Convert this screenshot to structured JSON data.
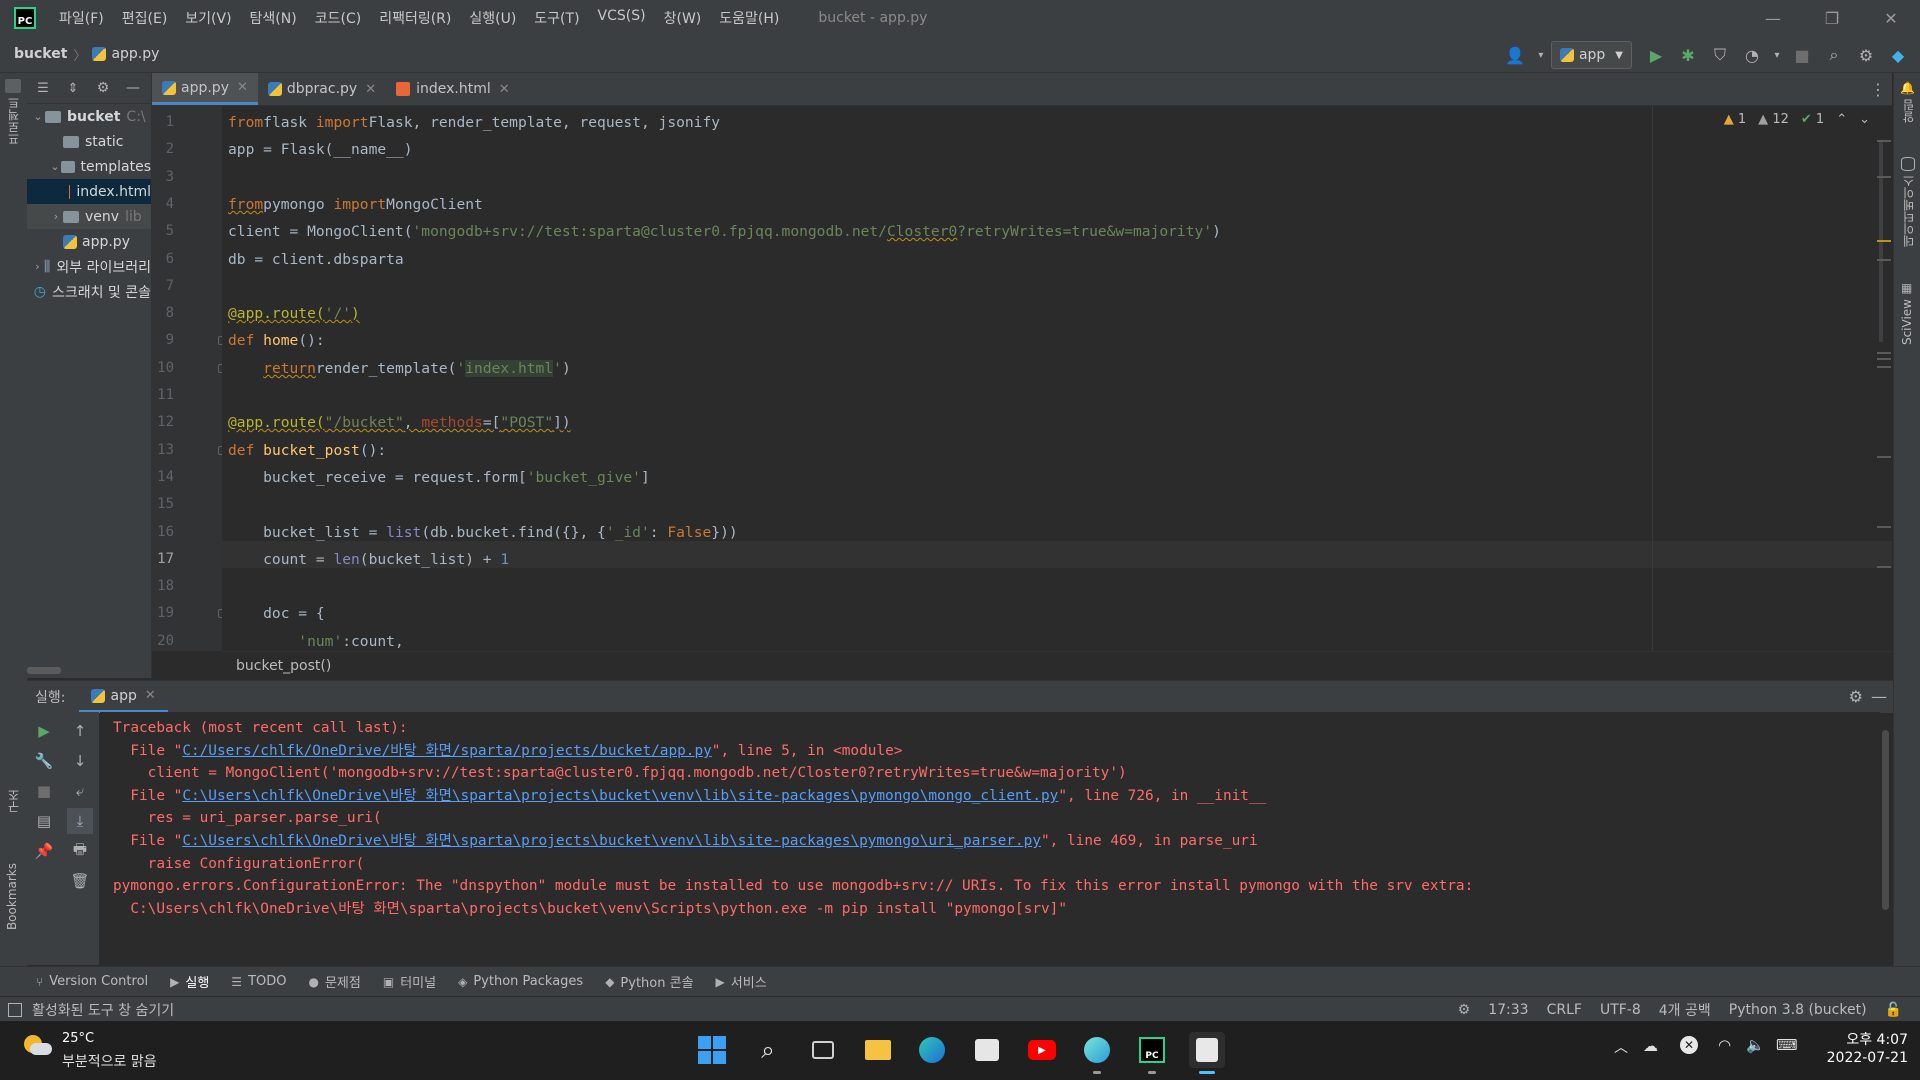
{
  "menu": [
    "파일(F)",
    "편집(E)",
    "보기(V)",
    "탐색(N)",
    "코드(C)",
    "리팩터링(R)",
    "실행(U)",
    "도구(T)",
    "VCS(S)",
    "창(W)",
    "도움말(H)"
  ],
  "window_title": "bucket - app.py",
  "app_logo_text": "PC",
  "breadcrumb": {
    "project": "bucket",
    "file": "app.py"
  },
  "run_config": "app",
  "left_strip": {
    "project": "프로젝트",
    "structure": "구조",
    "bookmarks": "Bookmarks"
  },
  "right_strip": {
    "notifications": "알림",
    "database": "데이터베이스",
    "sciview": "SciView"
  },
  "project_tree": [
    {
      "label": "bucket",
      "extra": "C:\\",
      "indent": 0,
      "arrow": "down",
      "icon": "folder-icon",
      "bold": true
    },
    {
      "label": "static",
      "extra": "",
      "indent": 1,
      "arrow": "",
      "icon": "folder-icon"
    },
    {
      "label": "templates",
      "extra": "",
      "indent": 1,
      "arrow": "down",
      "icon": "folder-icon"
    },
    {
      "label": "index.html",
      "extra": "",
      "indent": 2,
      "arrow": "",
      "icon": "html-file-icon",
      "selected": true
    },
    {
      "label": "venv",
      "extra": "lib",
      "indent": 1,
      "arrow": "right",
      "icon": "folder-icon",
      "highlight": true
    },
    {
      "label": "app.py",
      "extra": "",
      "indent": 1,
      "arrow": "",
      "icon": "python-file-icon"
    },
    {
      "label": "외부 라이브러리",
      "extra": "",
      "indent": 0,
      "arrow": "right",
      "icon": "library-icon"
    },
    {
      "label": "스크래치 및 콘솔",
      "extra": "",
      "indent": 0,
      "arrow": "",
      "icon": "scratch-icon"
    }
  ],
  "tabs": [
    {
      "label": "app.py",
      "icon": "python-file-icon",
      "active": true
    },
    {
      "label": "dbprac.py",
      "icon": "python-file-icon",
      "active": false
    },
    {
      "label": "index.html",
      "icon": "html-file-icon",
      "active": false
    }
  ],
  "inspections": {
    "warnings": "1",
    "weak_warnings": "12",
    "ok": "1"
  },
  "current_line": "17",
  "code_lines": [
    [
      [
        "kw",
        "from"
      ],
      [
        "",
        "flask "
      ],
      [
        "kw",
        "import"
      ],
      [
        "",
        "Flask, render_template, request, jsonify"
      ]
    ],
    [
      [
        "",
        "app = Flask(__name__)"
      ]
    ],
    [],
    [
      [
        "kw wavy",
        "from"
      ],
      [
        "",
        "pymongo "
      ],
      [
        "kw",
        "import"
      ],
      [
        "",
        "MongoClient"
      ]
    ],
    [
      [
        "",
        "client = MongoClient("
      ],
      [
        "str",
        "'mongodb+srv://test:sparta@cluster0.fpjqq.mongodb.net/"
      ],
      [
        "str wavy",
        "Closter0"
      ],
      [
        "str",
        "?retryWrites=true&w=majority'"
      ],
      [
        "",
        ")"
      ]
    ],
    [
      [
        "",
        "db = client.dbsparta"
      ]
    ],
    [],
    [
      [
        "deco wavy",
        "@app.route("
      ],
      [
        "str wavy",
        "'/'"
      ],
      [
        "deco wavy",
        ")"
      ]
    ],
    [
      [
        "kw",
        "def "
      ],
      [
        "fn",
        "home"
      ],
      [
        "",
        "():"
      ]
    ],
    [
      [
        "",
        "    "
      ],
      [
        "kw wavy",
        "return"
      ],
      [
        "",
        "render_template("
      ],
      [
        "str",
        "'"
      ],
      [
        "hl",
        "index.html"
      ],
      [
        "str",
        "'"
      ],
      [
        "",
        ")"
      ]
    ],
    [],
    [
      [
        "deco wavy",
        "@app.route("
      ],
      [
        "str wavy",
        "\"/bucket\""
      ],
      [
        "wavy",
        ", "
      ],
      [
        "param wavy",
        "methods"
      ],
      [
        "wavy",
        "=["
      ],
      [
        "str wavy",
        "\"POST\""
      ],
      [
        "wavy",
        "])"
      ]
    ],
    [
      [
        "kw",
        "def "
      ],
      [
        "fn",
        "bucket_post"
      ],
      [
        "",
        "():"
      ]
    ],
    [
      [
        "",
        "    bucket_receive = request.form["
      ],
      [
        "str",
        "'bucket_give'"
      ],
      [
        "",
        "]"
      ]
    ],
    [],
    [
      [
        "",
        "    bucket_list = "
      ],
      [
        "bi",
        "list"
      ],
      [
        "",
        "(db.bucket.find({}, {"
      ],
      [
        "str",
        "'_id'"
      ],
      [
        "",
        ": "
      ],
      [
        "kw",
        "False"
      ],
      [
        "",
        "}))"
      ]
    ],
    [
      [
        "",
        "    count = "
      ],
      [
        "bi",
        "len"
      ],
      [
        "",
        "(bucket_list) + "
      ],
      [
        "num",
        "1"
      ]
    ],
    [],
    [
      [
        "",
        "    doc = {"
      ]
    ],
    [
      [
        "",
        "        "
      ],
      [
        "str",
        "'num'"
      ],
      [
        "",
        ":count,"
      ]
    ]
  ],
  "function_breadcrumb": "bucket_post()",
  "run_panel": {
    "label": "실행:",
    "tab": "app"
  },
  "console_lines": [
    [
      [
        "",
        "Traceback (most recent call last):"
      ]
    ],
    [
      [
        "",
        "  File \""
      ],
      [
        "link",
        "C:/Users/chlfk/OneDrive/바탕 화면/sparta/projects/bucket/app.py"
      ],
      [
        "",
        "\", line 5, in <module>"
      ]
    ],
    [
      [
        "",
        "    client = MongoClient('mongodb+srv://test:sparta@cluster0.fpjqq.mongodb.net/Closter0?retryWrites=true&w=majority')"
      ]
    ],
    [
      [
        "",
        "  File \""
      ],
      [
        "link",
        "C:\\Users\\chlfk\\OneDrive\\바탕 화면\\sparta\\projects\\bucket\\venv\\lib\\site-packages\\pymongo\\mongo_client.py"
      ],
      [
        "",
        "\", line 726, in __init__"
      ]
    ],
    [
      [
        "",
        "    res = uri_parser.parse_uri("
      ]
    ],
    [
      [
        "",
        "  File \""
      ],
      [
        "link",
        "C:\\Users\\chlfk\\OneDrive\\바탕 화면\\sparta\\projects\\bucket\\venv\\lib\\site-packages\\pymongo\\uri_parser.py"
      ],
      [
        "",
        "\", line 469, in parse_uri"
      ]
    ],
    [
      [
        "",
        "    raise ConfigurationError("
      ]
    ],
    [
      [
        "",
        "pymongo.errors.ConfigurationError: The \"dnspython\" module must be installed to use mongodb+srv:// URIs. To fix this error install pymongo with the srv extra:"
      ]
    ],
    [
      [
        "",
        "  C:\\Users\\chlfk\\OneDrive\\바탕 화면\\sparta\\projects\\bucket\\venv\\Scripts\\python.exe -m pip install \"pymongo[srv]\""
      ]
    ]
  ],
  "tool_tabs": [
    {
      "label": "Version Control",
      "icon": "version-control-icon"
    },
    {
      "label": "실행",
      "icon": "run-icon",
      "active": true
    },
    {
      "label": "TODO",
      "icon": "todo-icon"
    },
    {
      "label": "문제점",
      "icon": "problems-icon"
    },
    {
      "label": "터미널",
      "icon": "terminal-icon"
    },
    {
      "label": "Python Packages",
      "icon": "packages-icon"
    },
    {
      "label": "Python 콘솔",
      "icon": "python-console-icon"
    },
    {
      "label": "서비스",
      "icon": "services-icon"
    }
  ],
  "status": {
    "message": "활성화된 도구 창 숨기기",
    "position": "17:33",
    "line_sep": "CRLF",
    "encoding": "UTF-8",
    "indent": "4개 공백",
    "interpreter": "Python 3.8 (bucket)"
  },
  "taskbar": {
    "temperature": "25°C",
    "weather": "부분적으로 맑음",
    "time": "오후 4:07",
    "date": "2022-07-21"
  },
  "colors": {
    "accent": "#4a88c7",
    "error_text": "#ff6b68",
    "link": "#589df6"
  }
}
